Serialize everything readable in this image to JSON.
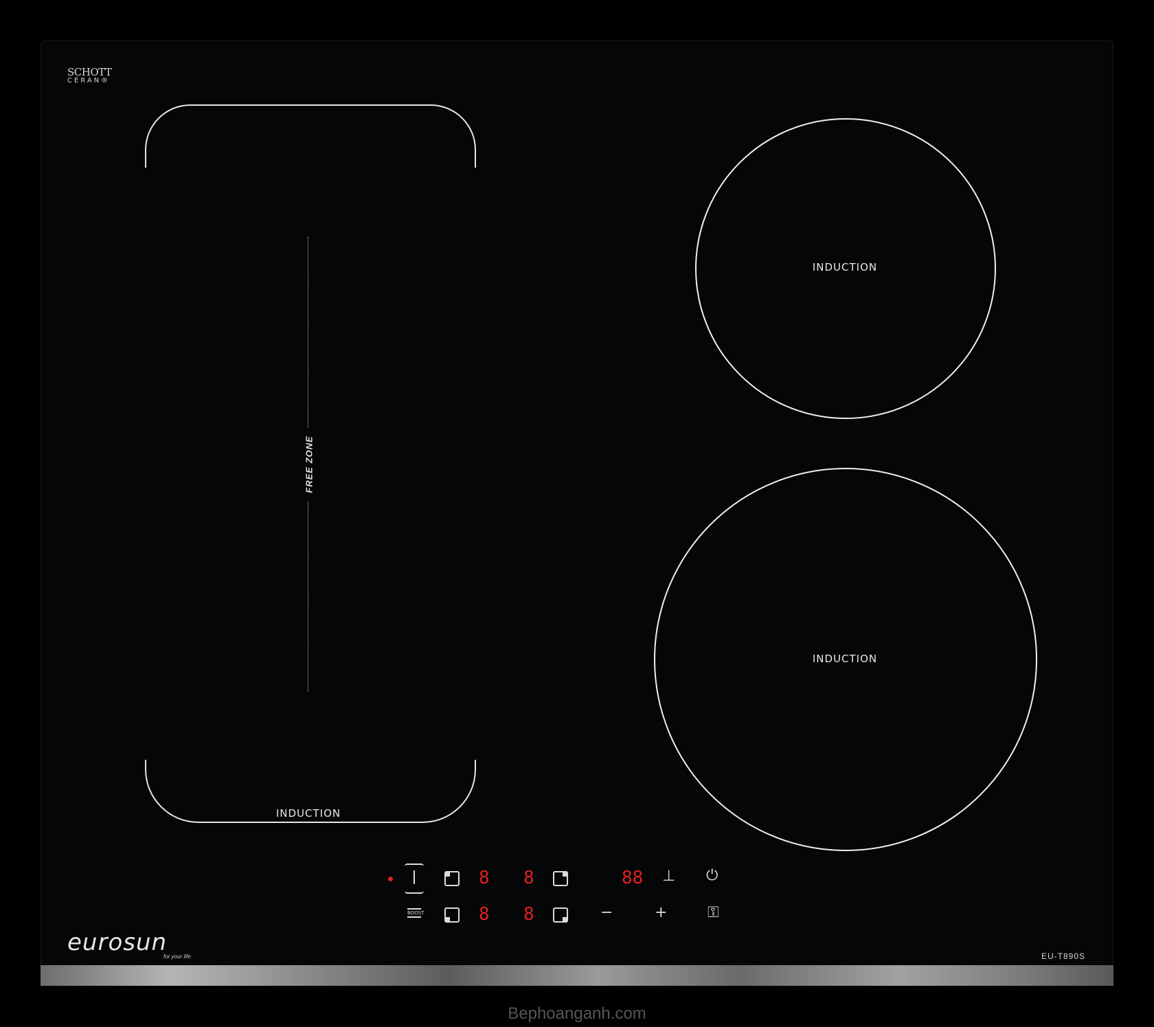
{
  "brand_plate": {
    "line1": "SCHOTT",
    "line2": "CERAN®"
  },
  "zones": {
    "flex_label": "INDUCTION",
    "free_zone_label": "FREE ZONE",
    "top_right_label": "INDUCTION",
    "bottom_right_label": "INDUCTION"
  },
  "controls": {
    "boost_label": "BOOST",
    "display_left_top": "8",
    "display_left_bottom": "8",
    "display_right_top": "8",
    "display_right_bottom": "8",
    "timer_display": "88",
    "minus": "−",
    "plus": "+",
    "power_symbol": "⏻",
    "lock_symbol": "⚿",
    "timer_symbol": "⊥"
  },
  "logo": {
    "name": "eurosun",
    "tagline": "for your life"
  },
  "model_number": "EU-T890S",
  "watermark": "Bephoanganh.com",
  "colors": {
    "panel": "#050607",
    "display_red": "#e22020",
    "lines": "#efefef"
  }
}
